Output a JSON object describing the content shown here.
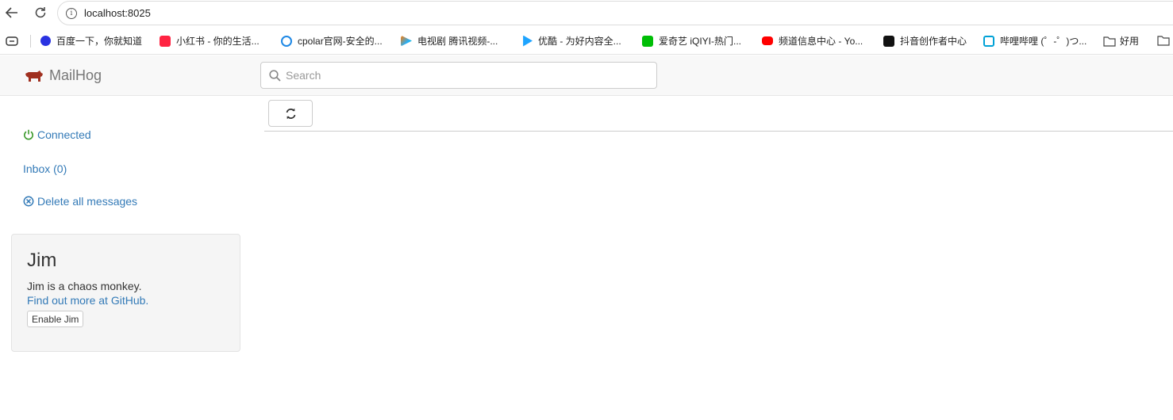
{
  "browser": {
    "url": "localhost:8025",
    "bookmarks": [
      {
        "label": "百度一下，你就知道",
        "icon": "baidu-icon",
        "color": "#2932e1"
      },
      {
        "label": "小红书 - 你的生活...",
        "icon": "xiaohongshu-icon",
        "color": "#ff2442"
      },
      {
        "label": "cpolar官网-安全的...",
        "icon": "cpolar-icon",
        "color": "#1e88e5"
      },
      {
        "label": "电视剧 腾讯视频-...",
        "icon": "tencent-video-icon",
        "color": "#20b0ff"
      },
      {
        "label": "优酷 - 为好内容全...",
        "icon": "youku-icon",
        "color": "#1ea4ff"
      },
      {
        "label": "爱奇艺 iQIYI-热门...",
        "icon": "iqiyi-icon",
        "color": "#00be06"
      },
      {
        "label": "频道信息中心 - Yo...",
        "icon": "youtube-icon",
        "color": "#ff0000"
      },
      {
        "label": "抖音创作者中心",
        "icon": "douyin-icon",
        "color": "#111111"
      },
      {
        "label": "哔哩哔哩 (゜-゜)つ...",
        "icon": "bilibili-icon",
        "color": "#00a1d6"
      },
      {
        "label": "好用",
        "icon": "folder-icon",
        "color": "#555555"
      }
    ]
  },
  "app": {
    "brand": "MailHog",
    "search_placeholder": "Search",
    "colors": {
      "link": "#337ab7",
      "connected": "#3c9a2d",
      "brand_logo": "#a03020"
    }
  },
  "sidebar": {
    "connected": "Connected",
    "inbox": "Inbox (0)",
    "delete_all": "Delete all messages"
  },
  "jim": {
    "title": "Jim",
    "description": "Jim is a chaos monkey.",
    "link": "Find out more at GitHub.",
    "button": "Enable Jim"
  }
}
